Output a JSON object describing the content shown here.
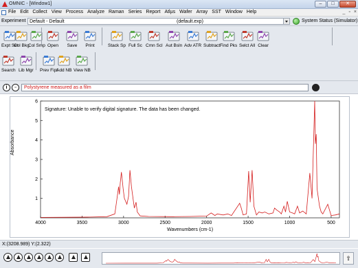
{
  "window": {
    "title": "OMNIC - [Window1]",
    "minimize": "–",
    "restore": "□",
    "close": "✕"
  },
  "menu": {
    "items": [
      "File",
      "Edit",
      "Collect",
      "View",
      "Process",
      "Analyze",
      "Raman",
      "Series",
      "Report",
      "Atlµs",
      "Wafer",
      "Array",
      "SST",
      "Window",
      "Help"
    ],
    "mdi": [
      "_",
      "▫",
      "×"
    ]
  },
  "experiment": {
    "label": "Experiment",
    "value": "Default - Default",
    "file": "(default.exp)",
    "status": "System Status (Simulator)"
  },
  "toolbar": {
    "row1": [
      {
        "label": "Expt Set",
        "icon": "experiment-setup-icon"
      },
      {
        "label": "Col Bkg",
        "icon": "collect-background-icon"
      },
      {
        "label": "Col Smp",
        "icon": "collect-sample-icon"
      },
      {
        "label": "Open",
        "icon": "folder-open-icon"
      },
      {
        "label": "Save",
        "icon": "floppy-disk-icon"
      },
      {
        "label": "Print",
        "icon": "printer-icon"
      },
      {
        "label": "Stack Sp",
        "icon": "stack-spectra-icon"
      },
      {
        "label": "Full Sc",
        "icon": "full-scale-icon"
      },
      {
        "label": "Cmn Scl",
        "icon": "common-scale-icon"
      },
      {
        "label": "Aut Bsln",
        "icon": "auto-baseline-icon"
      },
      {
        "label": "Adv ATR",
        "icon": "advanced-atr-icon"
      },
      {
        "label": "Subtract",
        "icon": "subtract-icon"
      },
      {
        "label": "Find Pks",
        "icon": "find-peaks-icon"
      },
      {
        "label": "Selct All",
        "icon": "select-all-icon"
      },
      {
        "label": "Clear",
        "icon": "clear-icon"
      }
    ],
    "row2": [
      {
        "label": "Search",
        "icon": "search-icon"
      },
      {
        "label": "Lib Mgr",
        "icon": "library-manager-icon"
      },
      {
        "label": "Prev Fipt",
        "icon": "preview-fingerprint-icon"
      },
      {
        "label": "Add NB",
        "icon": "add-notebook-icon"
      },
      {
        "label": "View NB",
        "icon": "view-notebook-icon"
      }
    ]
  },
  "spectrum": {
    "title": "Polystyrene measured as a film",
    "signature": "Signature: Unable to verify digital signature.  The data has been changed."
  },
  "chart_data": {
    "type": "line",
    "xlabel": "Wavenumbers (cm-1)",
    "ylabel": "Absorbance",
    "xlim": [
      4000,
      400
    ],
    "ylim": [
      0,
      6
    ],
    "xticks": [
      4000,
      3500,
      3000,
      2500,
      2000,
      1500,
      1000,
      500
    ],
    "yticks": [
      1,
      2,
      3,
      4,
      5,
      6
    ],
    "grid": false,
    "series": [
      {
        "color": "#d41c1c",
        "x": [
          4000,
          3700,
          3400,
          3200,
          3105,
          3082,
          3060,
          3050,
          3040,
          3026,
          3005,
          2990,
          2960,
          2940,
          2923,
          2905,
          2870,
          2850,
          2835,
          2800,
          2700,
          2400,
          2200,
          2000,
          1945,
          1900,
          1872,
          1800,
          1745,
          1700,
          1602,
          1583,
          1560,
          1520,
          1493,
          1475,
          1452,
          1430,
          1400,
          1370,
          1330,
          1300,
          1250,
          1200,
          1181,
          1155,
          1120,
          1100,
          1069,
          1050,
          1028,
          1000,
          965,
          940,
          906,
          880,
          842,
          800,
          757,
          730,
          698,
          690,
          680,
          670,
          640,
          620,
          600,
          541,
          500,
          450,
          400
        ],
        "y": [
          0.02,
          0.03,
          0.04,
          0.06,
          0.2,
          0.9,
          1.6,
          1.2,
          1.8,
          2.35,
          1.5,
          1.0,
          0.7,
          1.1,
          2.45,
          1.6,
          0.5,
          0.8,
          0.3,
          0.1,
          0.07,
          0.06,
          0.07,
          0.09,
          0.25,
          0.12,
          0.2,
          0.15,
          0.2,
          0.12,
          0.75,
          0.5,
          0.15,
          0.2,
          2.4,
          0.8,
          2.45,
          0.6,
          0.15,
          0.3,
          0.25,
          0.3,
          0.2,
          0.25,
          0.5,
          0.4,
          0.3,
          0.2,
          0.6,
          0.3,
          0.85,
          0.3,
          0.25,
          0.2,
          0.6,
          0.25,
          0.35,
          0.2,
          2.3,
          1.0,
          6.0,
          3.8,
          4.3,
          1.5,
          0.6,
          0.3,
          0.2,
          0.7,
          0.12,
          0.15,
          0.2
        ]
      }
    ]
  },
  "cursor": {
    "readout": "X:(3208.989)  Y:(2.322)"
  },
  "bottom": {
    "scroll": "⇧"
  }
}
